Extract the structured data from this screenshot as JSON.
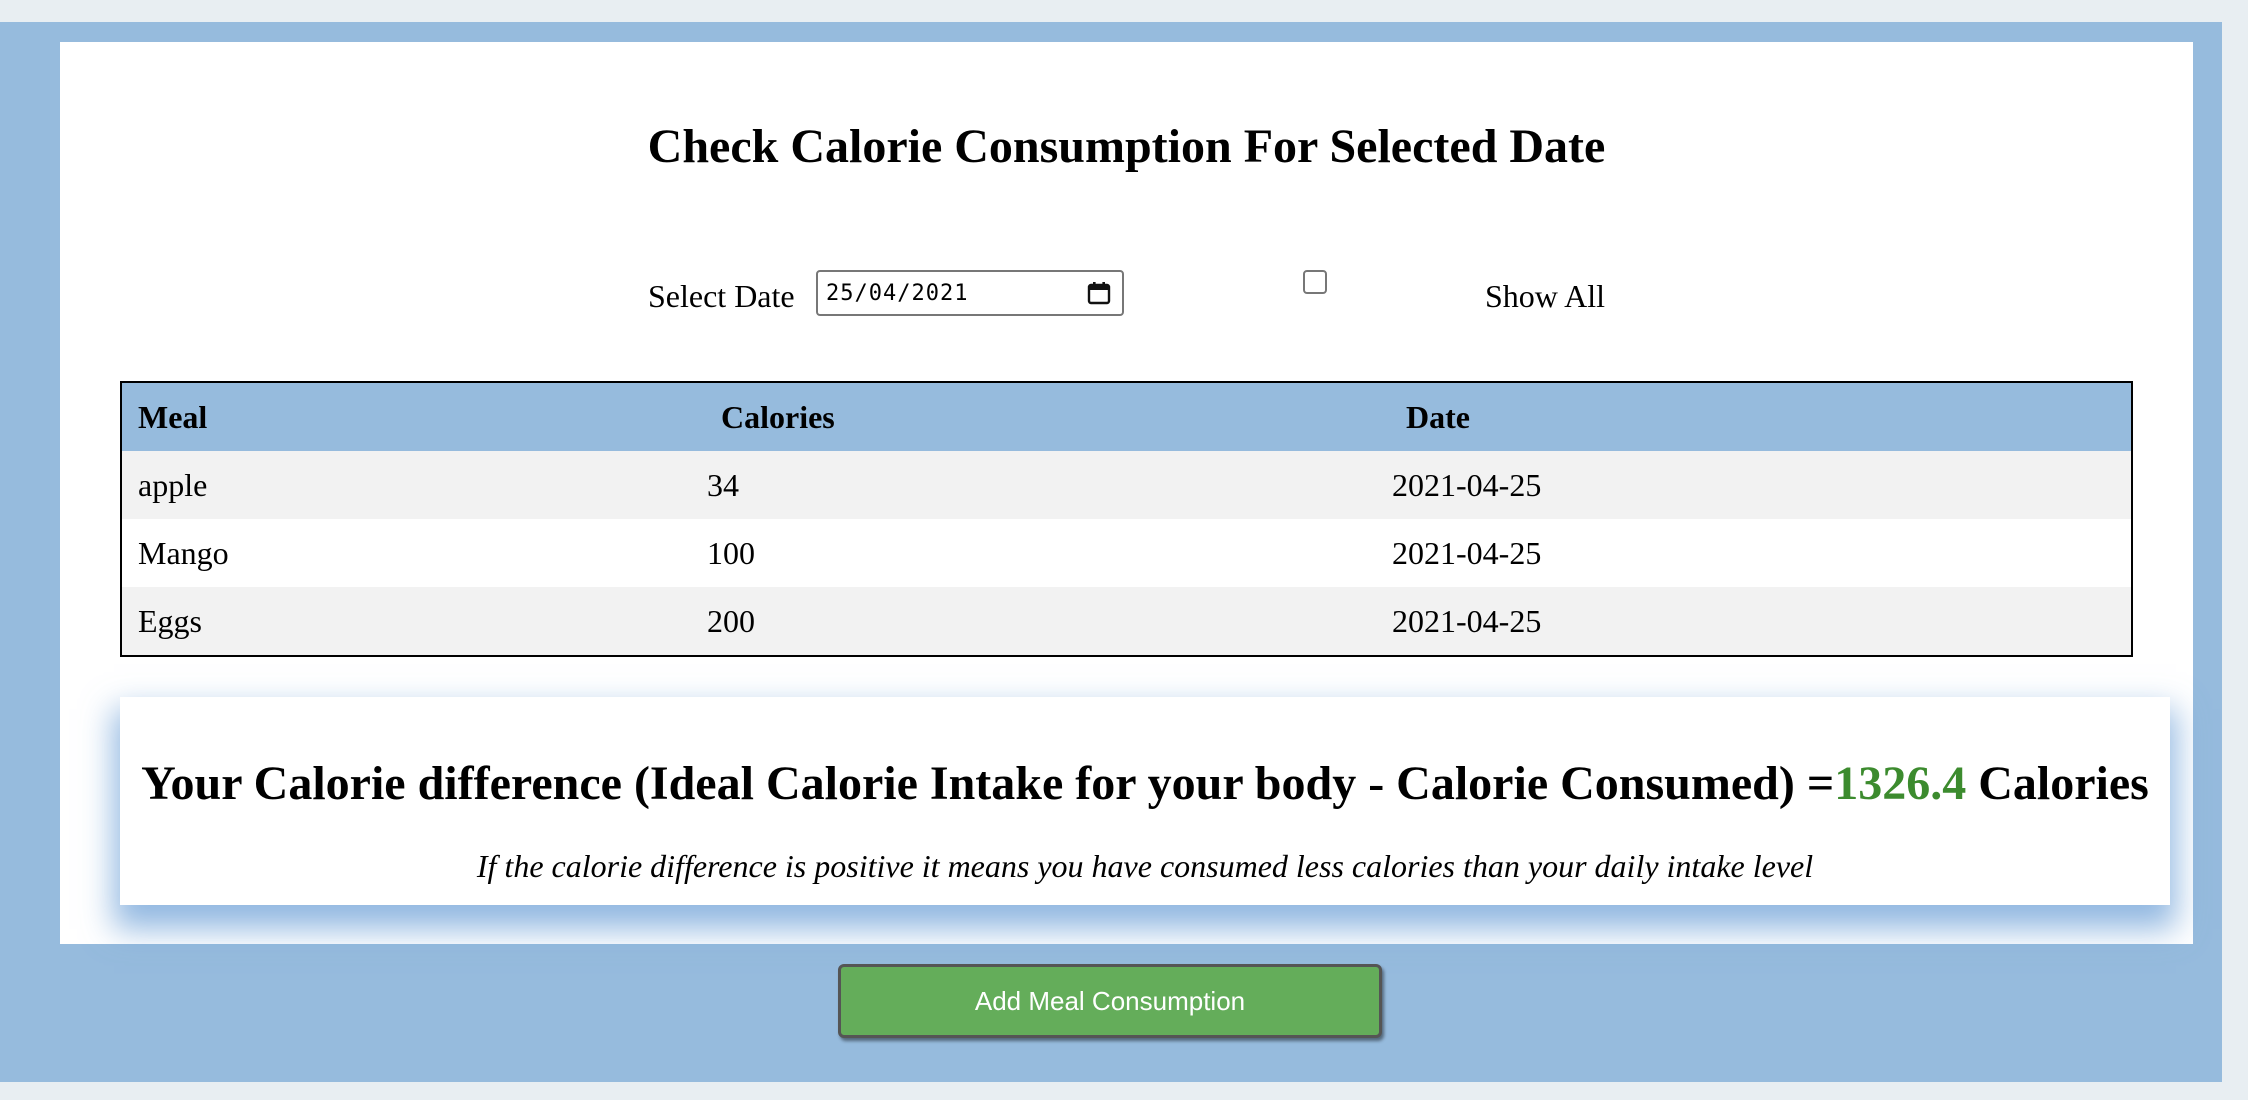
{
  "page": {
    "title": "Check Calorie Consumption For Selected Date"
  },
  "filter": {
    "select_date_label": "Select Date",
    "date_value": "25/04/2021",
    "show_all_label": "Show All",
    "show_all_checked": false
  },
  "table": {
    "headers": [
      "Meal",
      "Calories",
      "Date"
    ],
    "rows": [
      {
        "meal": "apple",
        "calories": "34",
        "date": "2021-04-25"
      },
      {
        "meal": "Mango",
        "calories": "100",
        "date": "2021-04-25"
      },
      {
        "meal": "Eggs",
        "calories": "200",
        "date": "2021-04-25"
      }
    ]
  },
  "summary": {
    "prefix": "Your Calorie difference (Ideal Calorie Intake for your body - Calorie Consumed) =",
    "value": "1326.4",
    "suffix": " Calories",
    "note": "If the calorie difference is positive it means you have consumed less calories than your daily intake level"
  },
  "actions": {
    "add_meal_label": "Add Meal Consumption"
  },
  "colors": {
    "page_background": "#96bbdd",
    "header_row": "#96bbdd",
    "positive_value": "#3c8b2e",
    "button": "#64ad5a"
  },
  "icons": {
    "date_picker": "calendar-icon"
  }
}
